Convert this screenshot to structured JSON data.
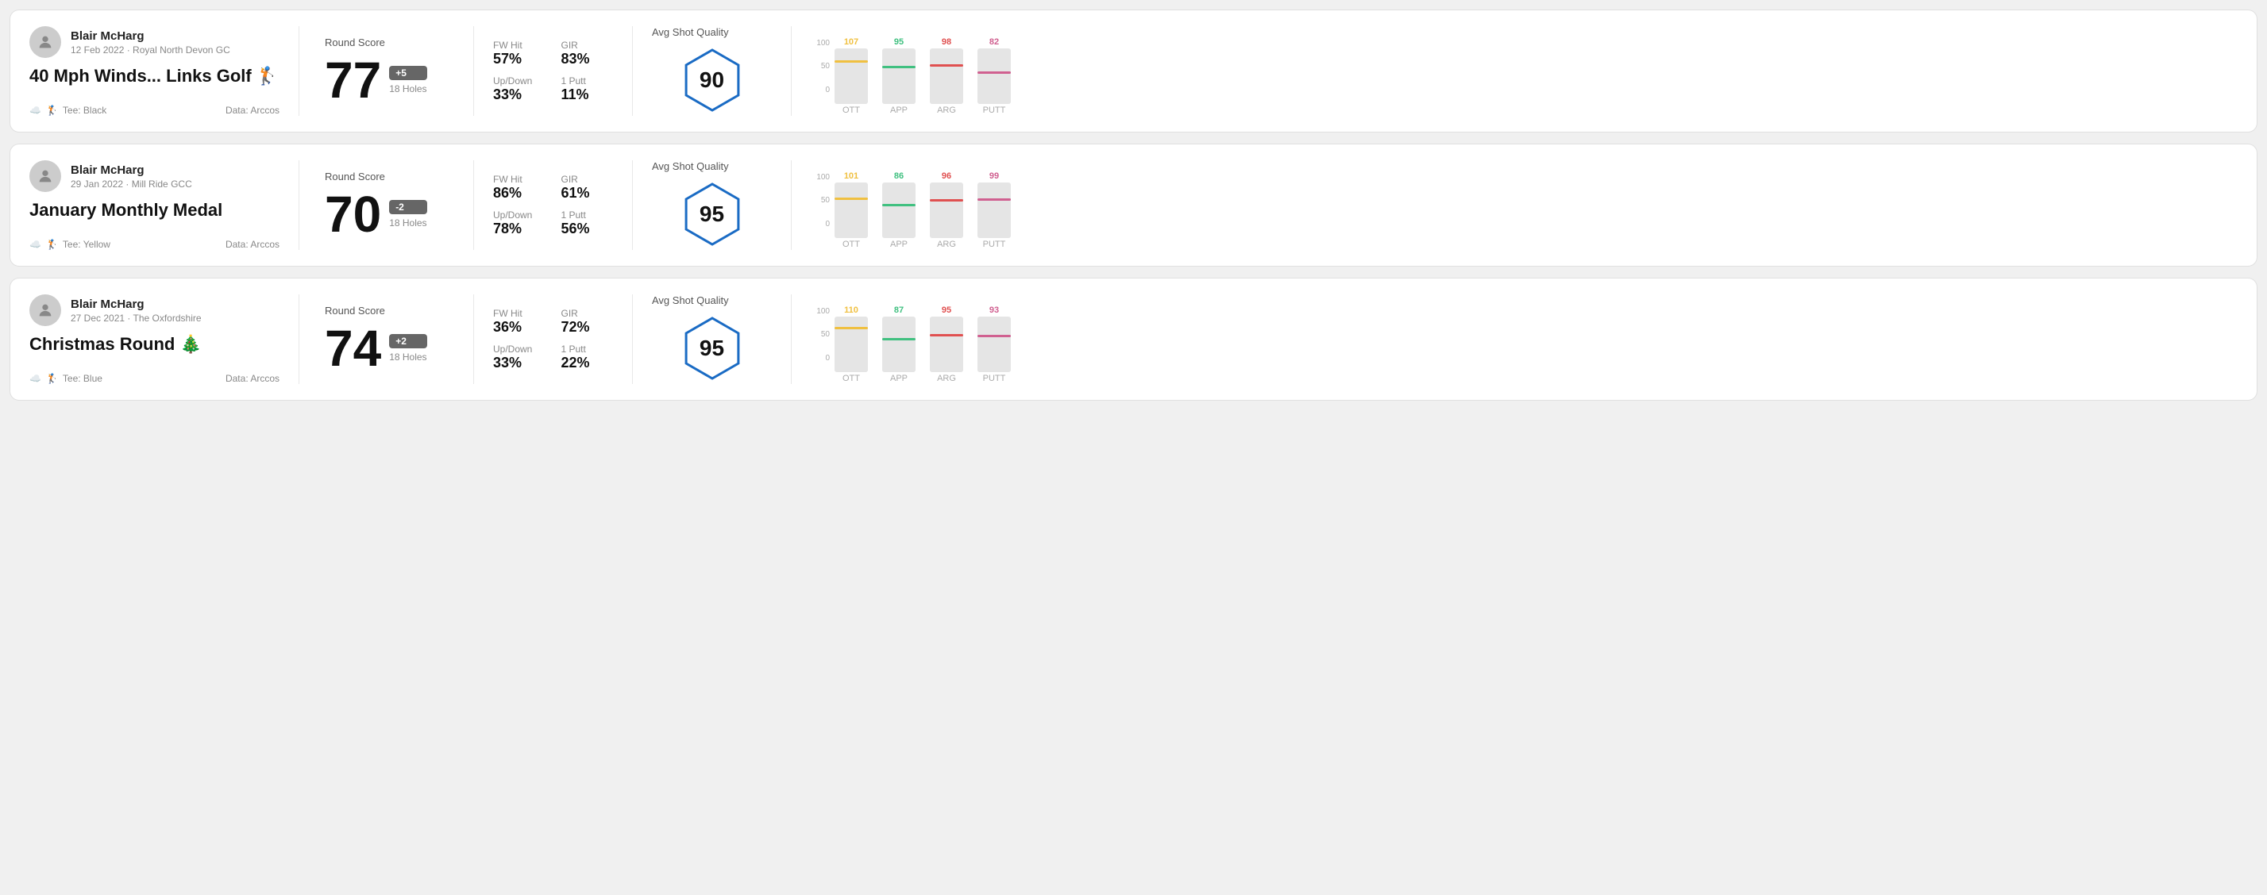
{
  "rounds": [
    {
      "id": "round1",
      "user_name": "Blair McHarg",
      "user_meta": "12 Feb 2022 · Royal North Devon GC",
      "title": "40 Mph Winds... Links Golf 🏌️",
      "tee": "Black",
      "data_source": "Data: Arccos",
      "round_score_label": "Round Score",
      "score": "77",
      "badge": "+5",
      "badge_type": "positive",
      "holes": "18 Holes",
      "fw_hit_label": "FW Hit",
      "fw_hit": "57%",
      "gir_label": "GIR",
      "gir": "83%",
      "updown_label": "Up/Down",
      "updown": "33%",
      "one_putt_label": "1 Putt",
      "one_putt": "11%",
      "avg_shot_quality_label": "Avg Shot Quality",
      "quality_score": "90",
      "chart": {
        "bars": [
          {
            "label": "OTT",
            "value": 107,
            "color": "#f0c040",
            "pct": 75
          },
          {
            "label": "APP",
            "value": 95,
            "color": "#40c080",
            "pct": 65
          },
          {
            "label": "ARG",
            "value": 98,
            "color": "#e05050",
            "pct": 68
          },
          {
            "label": "PUTT",
            "value": 82,
            "color": "#d06090",
            "pct": 55
          }
        ],
        "y_labels": [
          "100",
          "50",
          "0"
        ]
      }
    },
    {
      "id": "round2",
      "user_name": "Blair McHarg",
      "user_meta": "29 Jan 2022 · Mill Ride GCC",
      "title": "January Monthly Medal",
      "tee": "Yellow",
      "data_source": "Data: Arccos",
      "round_score_label": "Round Score",
      "score": "70",
      "badge": "-2",
      "badge_type": "negative",
      "holes": "18 Holes",
      "fw_hit_label": "FW Hit",
      "fw_hit": "86%",
      "gir_label": "GIR",
      "gir": "61%",
      "updown_label": "Up/Down",
      "updown": "78%",
      "one_putt_label": "1 Putt",
      "one_putt": "56%",
      "avg_shot_quality_label": "Avg Shot Quality",
      "quality_score": "95",
      "chart": {
        "bars": [
          {
            "label": "OTT",
            "value": 101,
            "color": "#f0c040",
            "pct": 70
          },
          {
            "label": "APP",
            "value": 86,
            "color": "#40c080",
            "pct": 58
          },
          {
            "label": "ARG",
            "value": 96,
            "color": "#e05050",
            "pct": 67
          },
          {
            "label": "PUTT",
            "value": 99,
            "color": "#d06090",
            "pct": 69
          }
        ],
        "y_labels": [
          "100",
          "50",
          "0"
        ]
      }
    },
    {
      "id": "round3",
      "user_name": "Blair McHarg",
      "user_meta": "27 Dec 2021 · The Oxfordshire",
      "title": "Christmas Round 🎄",
      "tee": "Blue",
      "data_source": "Data: Arccos",
      "round_score_label": "Round Score",
      "score": "74",
      "badge": "+2",
      "badge_type": "positive",
      "holes": "18 Holes",
      "fw_hit_label": "FW Hit",
      "fw_hit": "36%",
      "gir_label": "GIR",
      "gir": "72%",
      "updown_label": "Up/Down",
      "updown": "33%",
      "one_putt_label": "1 Putt",
      "one_putt": "22%",
      "avg_shot_quality_label": "Avg Shot Quality",
      "quality_score": "95",
      "chart": {
        "bars": [
          {
            "label": "OTT",
            "value": 110,
            "color": "#f0c040",
            "pct": 78
          },
          {
            "label": "APP",
            "value": 87,
            "color": "#40c080",
            "pct": 59
          },
          {
            "label": "ARG",
            "value": 95,
            "color": "#e05050",
            "pct": 66
          },
          {
            "label": "PUTT",
            "value": 93,
            "color": "#d06090",
            "pct": 64
          }
        ],
        "y_labels": [
          "100",
          "50",
          "0"
        ]
      }
    }
  ]
}
